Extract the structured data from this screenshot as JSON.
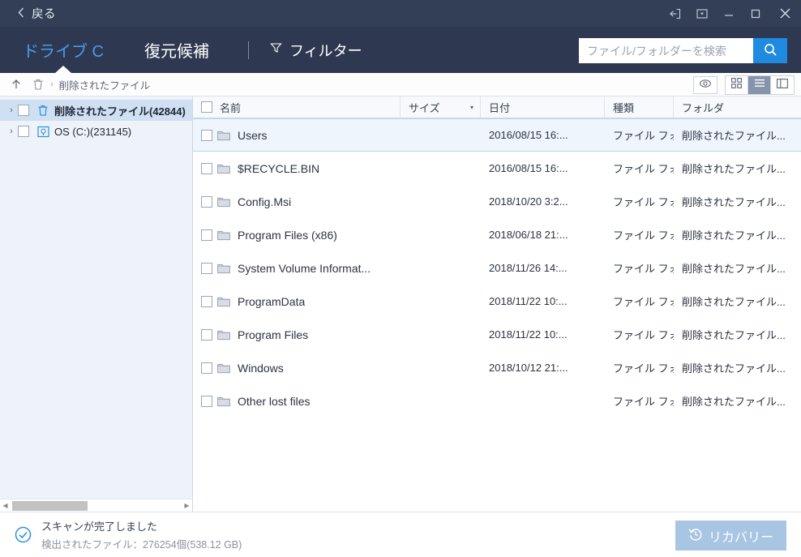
{
  "titlebar": {
    "back_label": "戻る",
    "back_icon": "chevron-left-icon",
    "controls": [
      {
        "name": "export-icon",
        "label": ""
      },
      {
        "name": "dropdown-box-icon",
        "label": ""
      },
      {
        "name": "minimize-icon",
        "label": ""
      },
      {
        "name": "maximize-icon",
        "label": ""
      },
      {
        "name": "close-icon",
        "label": ""
      }
    ]
  },
  "navbar": {
    "tab_drive": "ドライブ C",
    "tab_candidates": "復元候補",
    "filter_label": "フィルター",
    "filter_icon": "funnel-icon",
    "active_tab": "ドライブ C"
  },
  "search": {
    "value": "",
    "placeholder": "ファイル/フォルダーを検索",
    "button_icon": "search-icon"
  },
  "breadcrumb": {
    "up_icon": "arrow-up-icon",
    "trash_icon": "trash-icon",
    "separator": "›",
    "path": "削除されたファイル"
  },
  "view_toggles": {
    "preview_icon": "eye-icon",
    "grid_icon": "grid-view-icon",
    "list_icon": "list-view-icon",
    "detail_icon": "detail-pane-icon",
    "active": "list-view-icon"
  },
  "sidebar": {
    "items": [
      {
        "label": "削除されたファイル(42844)",
        "icon": "trash-icon",
        "chevron": "›",
        "selected": true,
        "bold": true
      },
      {
        "label": "OS (C:)(231145)",
        "icon": "drive-icon",
        "chevron": "›",
        "selected": false,
        "bold": false
      }
    ],
    "scrollbar": {
      "left_arrow": "◀",
      "right_arrow": "▶"
    }
  },
  "table": {
    "columns": [
      {
        "key": "name",
        "label": "名前"
      },
      {
        "key": "size",
        "label": "サイズ"
      },
      {
        "key": "date",
        "label": "日付"
      },
      {
        "key": "type",
        "label": "種類"
      },
      {
        "key": "folder",
        "label": "フォルダ"
      }
    ],
    "sort_caret": "▾",
    "sorted_column": "サイズ",
    "rows": [
      {
        "name": "Users",
        "size": "",
        "date": "2016/08/15 16:...",
        "type": "ファイル フォ...",
        "folder": "削除されたファイル...",
        "selected": true
      },
      {
        "name": "$RECYCLE.BIN",
        "size": "",
        "date": "2016/08/15 16:...",
        "type": "ファイル フォ...",
        "folder": "削除されたファイル...",
        "selected": false
      },
      {
        "name": "Config.Msi",
        "size": "",
        "date": "2018/10/20 3:2...",
        "type": "ファイル フォ...",
        "folder": "削除されたファイル...",
        "selected": false
      },
      {
        "name": "Program Files (x86)",
        "size": "",
        "date": "2018/06/18 21:...",
        "type": "ファイル フォ...",
        "folder": "削除されたファイル...",
        "selected": false
      },
      {
        "name": "System Volume Informat...",
        "size": "",
        "date": "2018/11/26 14:...",
        "type": "ファイル フォ...",
        "folder": "削除されたファイル...",
        "selected": false
      },
      {
        "name": "ProgramData",
        "size": "",
        "date": "2018/11/22 10:...",
        "type": "ファイル フォ...",
        "folder": "削除されたファイル...",
        "selected": false
      },
      {
        "name": "Program Files",
        "size": "",
        "date": "2018/11/22 10:...",
        "type": "ファイル フォ...",
        "folder": "削除されたファイル...",
        "selected": false
      },
      {
        "name": "Windows",
        "size": "",
        "date": "2018/10/12 21:...",
        "type": "ファイル フォ...",
        "folder": "削除されたファイル...",
        "selected": false
      },
      {
        "name": "Other lost files",
        "size": "",
        "date": "",
        "type": "ファイル フォ...",
        "folder": "削除されたファイル...",
        "selected": false
      }
    ]
  },
  "status": {
    "icon": "check-circle-icon",
    "main": "スキャンが完了しました",
    "sub": "検出されたファイル：276254個(538.12 GB)"
  },
  "recover": {
    "label": "リカバリー",
    "icon": "restore-clock-icon"
  },
  "colors": {
    "titlebar": "#333f57",
    "navbar": "#2e3951",
    "accent": "#4a9bea",
    "search_button": "#1e8ae0",
    "sidebar": "#eef3fa",
    "sidebar_selected": "#cfe0f3",
    "row_selected": "#eef5fc",
    "recover_button": "#a9c5e4",
    "status_icon": "#2f8fe0"
  }
}
